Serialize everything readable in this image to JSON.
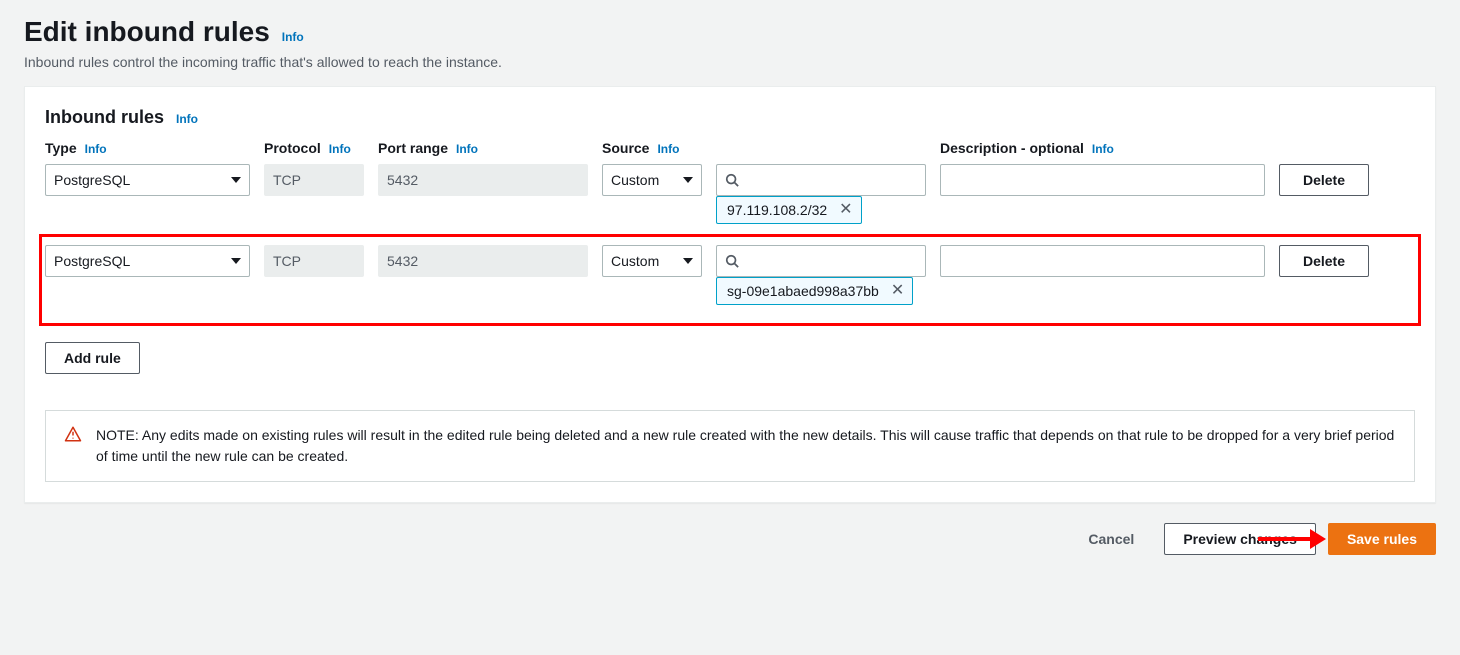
{
  "page": {
    "title": "Edit inbound rules",
    "info_label": "Info",
    "subtitle": "Inbound rules control the incoming traffic that's allowed to reach the instance."
  },
  "panel": {
    "title": "Inbound rules",
    "info_label": "Info"
  },
  "columns": {
    "type": "Type",
    "protocol": "Protocol",
    "port_range": "Port range",
    "source": "Source",
    "description": "Description - optional",
    "info_label": "Info"
  },
  "rules": [
    {
      "type_value": "PostgreSQL",
      "protocol": "TCP",
      "port_range": "5432",
      "source_mode": "Custom",
      "source_search": "",
      "source_tag": "97.119.108.2/32",
      "description": "",
      "delete_label": "Delete"
    },
    {
      "type_value": "PostgreSQL",
      "protocol": "TCP",
      "port_range": "5432",
      "source_mode": "Custom",
      "source_search": "",
      "source_tag": "sg-09e1abaed998a37bb",
      "description": "",
      "delete_label": "Delete"
    }
  ],
  "buttons": {
    "add_rule": "Add rule",
    "cancel": "Cancel",
    "preview": "Preview changes",
    "save": "Save rules"
  },
  "note": {
    "text": "NOTE: Any edits made on existing rules will result in the edited rule being deleted and a new rule created with the new details. This will cause traffic that depends on that rule to be dropped for a very brief period of time until the new rule can be created."
  },
  "icons": {
    "search": "search-icon",
    "close": "close-icon",
    "warning": "warning-icon",
    "caret": "chevron-down-icon"
  }
}
